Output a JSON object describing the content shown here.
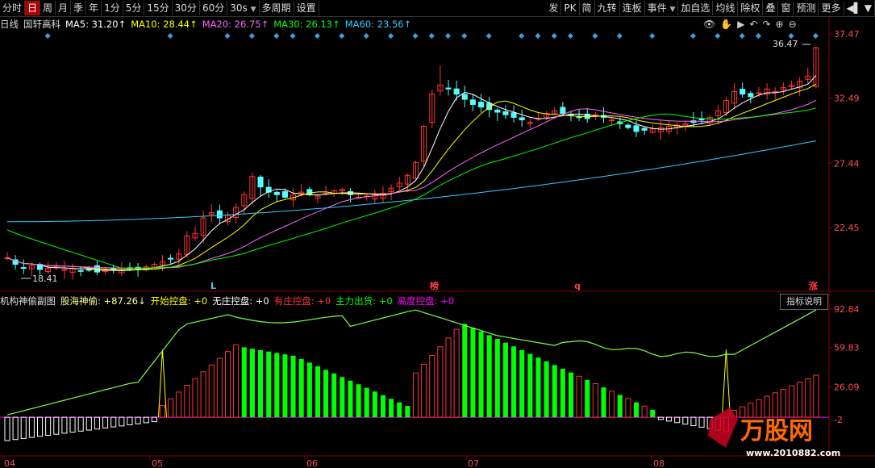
{
  "toolbar": {
    "left": [
      "分时",
      "日",
      "周",
      "月",
      "季",
      "年",
      "1分",
      "5分",
      "15分",
      "30分",
      "60分",
      "30s",
      "多周期",
      "设置"
    ],
    "active_index": 1,
    "dropdown_index": 11,
    "right": [
      "发",
      "PK",
      "简",
      "九转",
      "连板",
      "事件",
      "加自选",
      "均线",
      "除权",
      "叠",
      "窗",
      "预测",
      "更多"
    ],
    "right_dropdown_index": 5
  },
  "main_chart": {
    "period_label": "日线",
    "stock_name": "国轩高科",
    "ma": [
      {
        "label": "MA5: 31.20↑",
        "color": "#ffffff"
      },
      {
        "label": "MA10: 28.44↑",
        "color": "#ffff00"
      },
      {
        "label": "MA20: 26.75↑",
        "color": "#ff66ff"
      },
      {
        "label": "MA30: 26.13↑",
        "color": "#00ff00"
      },
      {
        "label": "MA60: 23.56↑",
        "color": "#33ccff"
      }
    ],
    "y_ticks": [
      "37.47",
      "32.49",
      "27.44",
      "22.45"
    ],
    "high_label": "36.47",
    "low_label": "18.41",
    "markers": [
      "L",
      "榜",
      "q",
      "涨"
    ],
    "up_color": "#ff3232",
    "down_color": "#54ffff"
  },
  "indicator": {
    "title": "机构神偷副图",
    "items": [
      {
        "label": "股海神偷: +87.26↓",
        "color": "#ffff99"
      },
      {
        "label": "开始控盘: +0",
        "color": "#ffff00"
      },
      {
        "label": "无庄控盘: +0",
        "color": "#ffffff"
      },
      {
        "label": "有庄控盘: +0",
        "color": "#ff3232"
      },
      {
        "label": "主力出货: +0",
        "color": "#00ff00"
      },
      {
        "label": "高度控盘: +0",
        "color": "#ff00ff"
      }
    ],
    "button": "指标说明",
    "y_ticks": [
      "92.84",
      "59.83",
      "26.09",
      "-2"
    ]
  },
  "x_axis": [
    "04",
    "05",
    "06",
    "07",
    "08"
  ],
  "watermark": {
    "brand": "万股网",
    "url": "www.2010882.com"
  }
}
